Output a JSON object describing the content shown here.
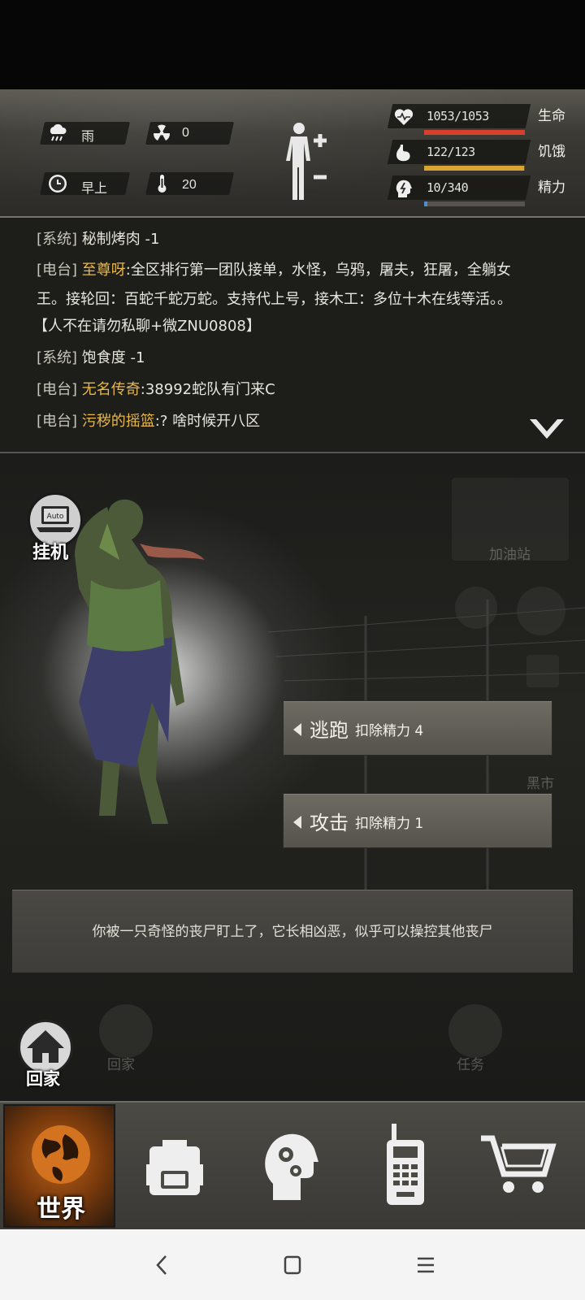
{
  "status": {
    "weather": "雨",
    "radiation": "0",
    "time_of_day": "早上",
    "temperature": "20"
  },
  "stats": [
    {
      "label": "生命",
      "value": "1053/1053",
      "fraction": 1.0,
      "color": "#d8402c",
      "icon": "heart-icon"
    },
    {
      "label": "饥饿",
      "value": "122/123",
      "fraction": 0.99,
      "color": "#d9a431",
      "icon": "stomach-icon"
    },
    {
      "label": "精力",
      "value": "10/340",
      "fraction": 0.03,
      "color": "#4f8fd0",
      "icon": "head-energy-icon"
    }
  ],
  "log": [
    {
      "tag": "[系统]",
      "name": "",
      "msg": "秘制烤肉 -1"
    },
    {
      "tag": "[电台]",
      "name": "至尊呀",
      "msg": ":全区排行第一团队接单，水怪，乌鸦，屠夫，狂屠，全躺女"
    },
    {
      "tag": "",
      "name": "",
      "msg": "王。接轮回：百蛇千蛇万蛇。支持代上号，接木工：多位十木在线等活。。"
    },
    {
      "tag": "",
      "name": "",
      "msg": "【人不在请勿私聊+微ZNU0808】"
    },
    {
      "tag": "[系统]",
      "name": "",
      "msg": "饱食度 -1"
    },
    {
      "tag": "[电台]",
      "name": "无名传奇",
      "msg": ":38992蛇队有门来C"
    },
    {
      "tag": "[电台]",
      "name": "污秽的摇篮",
      "msg": ":? 啥时候开八区"
    }
  ],
  "scene": {
    "auto_label": "挂机",
    "auto_badge": "Auto",
    "gas_station": "加油站",
    "black_market": "黑市",
    "home_bg": "回家",
    "task_bg": "任务",
    "home_label": "回家"
  },
  "actions": {
    "flee": {
      "label": "逃跑",
      "cost": "扣除精力 4"
    },
    "attack": {
      "label": "攻击",
      "cost": "扣除精力 1"
    }
  },
  "event_text": "你被一只奇怪的丧尸盯上了，它长相凶恶，似乎可以操控其他丧尸",
  "nav": [
    {
      "label": "世界",
      "icon": "globe-icon",
      "active": true
    },
    {
      "label": "",
      "icon": "backpack-icon",
      "active": false
    },
    {
      "label": "",
      "icon": "brain-skills-icon",
      "active": false
    },
    {
      "label": "",
      "icon": "walkie-talkie-icon",
      "active": false
    },
    {
      "label": "",
      "icon": "shopping-cart-icon",
      "active": false
    }
  ]
}
